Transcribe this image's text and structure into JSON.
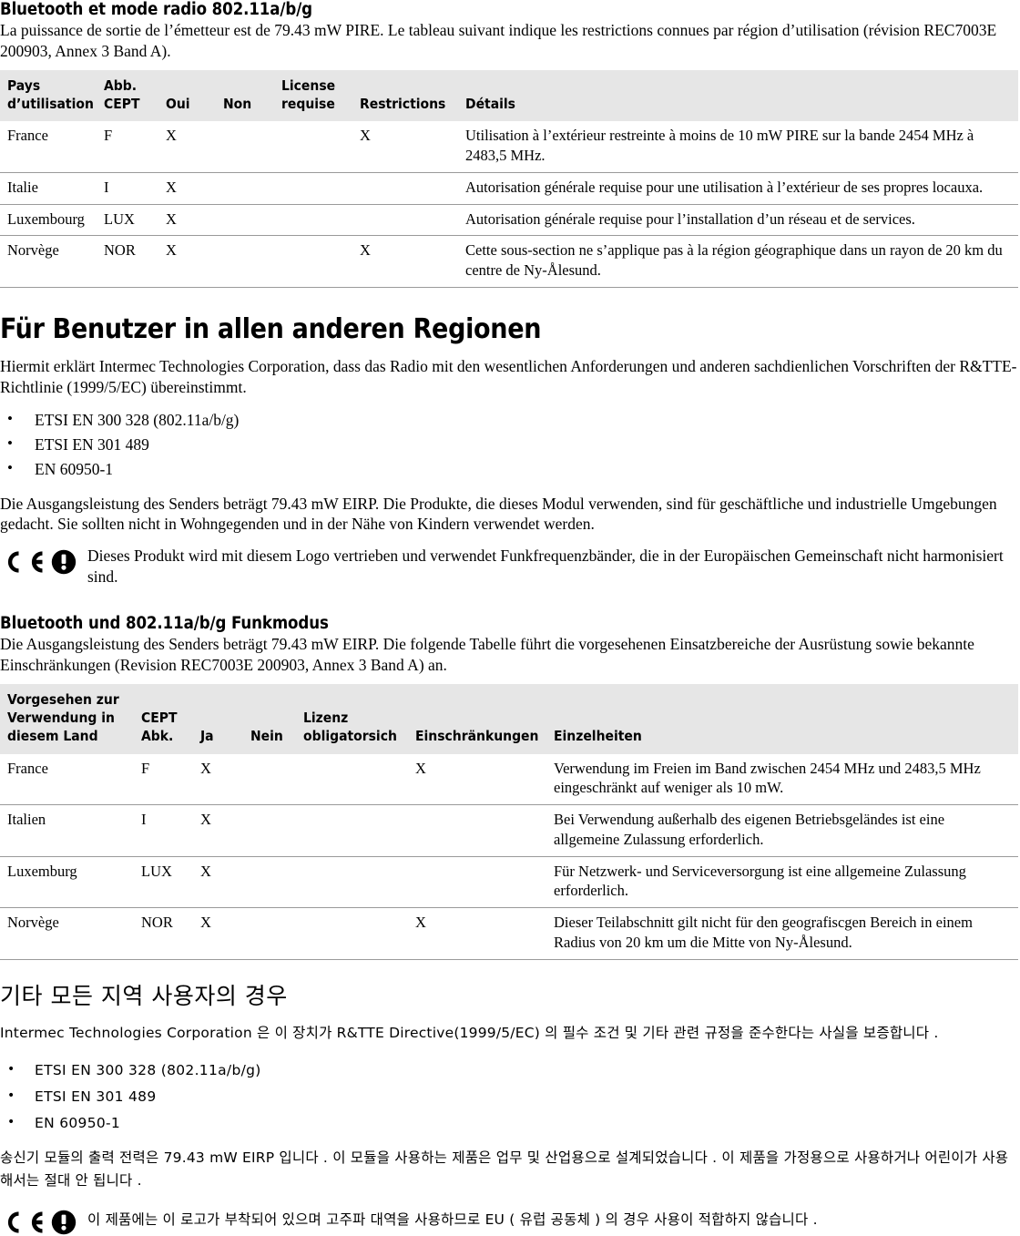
{
  "section_fr": {
    "heading": "Bluetooth et mode radio 802.11a/b/g",
    "intro": "La puissance de sortie de l’émetteur est de 79.43 mW PIRE. Le tableau suivant indique les restrictions connues par région d’utilisation (révision REC7003E 200903, Annex 3 Band A).",
    "table": {
      "headers": {
        "country_l1": "Pays",
        "country_l2": "d’utilisation",
        "cept_l1": "Abb.",
        "cept_l2": "CEPT",
        "yes": "Oui",
        "no": "Non",
        "license_l1": "License",
        "license_l2": "requise",
        "restrictions": "Restrictions",
        "details": "Détails"
      },
      "rows": [
        {
          "country": "France",
          "cept": "F",
          "yes": "X",
          "no": "",
          "license": "",
          "restrictions": "X",
          "details": "Utilisation à l’extérieur restreinte à moins de 10 mW PIRE sur la bande 2454 MHz à 2483,5 MHz."
        },
        {
          "country": "Italie",
          "cept": "I",
          "yes": "X",
          "no": "",
          "license": "",
          "restrictions": "",
          "details": "Autorisation générale requise pour une utilisation à l’extérieur de ses propres locauxa."
        },
        {
          "country": "Luxembourg",
          "cept": "LUX",
          "yes": "X",
          "no": "",
          "license": "",
          "restrictions": "",
          "details": "Autorisation générale requise pour l’installation d’un réseau et de services."
        },
        {
          "country": "Norvège",
          "cept": "NOR",
          "yes": "X",
          "no": "",
          "license": "",
          "restrictions": "X",
          "details": "Cette sous-section ne s’applique pas à la région géographique dans un rayon de 20 km du centre de Ny-Ålesund."
        }
      ]
    }
  },
  "section_de": {
    "heading": "Für Benutzer in allen anderen Regionen",
    "declaration": "Hiermit erklärt Intermec Technologies Corporation, dass das Radio mit den wesentlichen Anforderungen und anderen sachdienlichen Vorschriften der R&TTE-Richtlinie (1999/5/EC) übereinstimmt.",
    "standards": [
      "ETSI EN 300 328 (802.11a/b/g)",
      "ETSI EN 301 489",
      "EN 60950-1"
    ],
    "power_note": "Die Ausgangsleistung des Senders beträgt 79.43 mW EIRP. Die Produkte, die dieses Modul verwenden, sind für geschäftliche und industrielle Umgebungen gedacht. Sie sollten nicht in Wohngegenden und in der Nähe von Kindern verwendet werden.",
    "ce_notice": "Dieses Produkt wird mit diesem Logo vertrieben und verwendet Funkfrequenzbänder, die in der Europäischen Gemeinschaft nicht harmonisiert sind.",
    "subheading": "Bluetooth und 802.11a/b/g Funkmodus",
    "intro": "Die Ausgangsleistung des Senders beträgt 79.43 mW EIRP. Die folgende Tabelle führt die vorgesehenen Einsatzbereiche der Ausrüstung sowie bekannte Einschränkungen (Revision REC7003E 200903, Annex 3 Band A) an.",
    "table": {
      "headers": {
        "country_l1": "Vorgesehen zur",
        "country_l2": "Verwendung in",
        "country_l3": "diesem Land",
        "cept_l1": "CEPT",
        "cept_l2": "Abk.",
        "yes": "Ja",
        "no": "Nein",
        "license_l1": "Lizenz",
        "license_l2": "obligatorsich",
        "restrictions": "Einschränkungen",
        "details": "Einzelheiten"
      },
      "rows": [
        {
          "country": "France",
          "cept": "F",
          "yes": "X",
          "no": "",
          "license": "",
          "restrictions": "X",
          "details": "Verwendung im Freien im Band zwischen 2454 MHz und 2483,5 MHz eingeschränkt auf weniger als 10 mW."
        },
        {
          "country": "Italien",
          "cept": "I",
          "yes": "X",
          "no": "",
          "license": "",
          "restrictions": "",
          "details": "Bei Verwendung außerhalb des eigenen Betriebsgeländes ist eine allgemeine Zulassung erforderlich."
        },
        {
          "country": "Luxemburg",
          "cept": "LUX",
          "yes": "X",
          "no": "",
          "license": "",
          "restrictions": "",
          "details": "Für Netzwerk- und Serviceversorgung ist eine allgemeine Zulassung erforderlich."
        },
        {
          "country": "Norvège",
          "cept": "NOR",
          "yes": "X",
          "no": "",
          "license": "",
          "restrictions": "X",
          "details": "Dieser Teilabschnitt gilt nicht für den geografiscgen Bereich in einem Radius von 20 km um die Mitte von Ny-Ålesund."
        }
      ]
    }
  },
  "section_kr": {
    "heading": "기타 모든 지역 사용자의 경우",
    "declaration": "Intermec Technologies Corporation 은 이 장치가 R&TTE Directive(1999/5/EC) 의 필수 조건 및 기타 관련 규정을 준수한다는 사실을 보증합니다 .",
    "standards": [
      "ETSI EN 300 328 (802.11a/b/g)",
      "ETSI EN 301 489",
      "EN 60950-1"
    ],
    "power_note": "송신기 모듈의 출력 전력은 79.43 mW EIRP 입니다 . 이 모듈을 사용하는 제품은 업무 및 산업용으로 설계되었습니다 . 이 제품을 가정용으로 사용하거나 어린이가 사용해서는 절대 안 됩니다 .",
    "ce_notice": "이 제품에는 이 로고가 부착되어 있으며 고주파 대역을 사용하므로 EU ( 유럽 공동체 ) 의 경우 사용이 적합하지 않습니다 ."
  },
  "icons": {
    "ce_mark": "ce-mark-icon",
    "alert_circle": "exclamation-circle-icon"
  },
  "colors": {
    "table_header_bg": "#e6e6e6",
    "rule": "#9a9a9a",
    "text": "#000000",
    "page_bg": "#ffffff"
  }
}
